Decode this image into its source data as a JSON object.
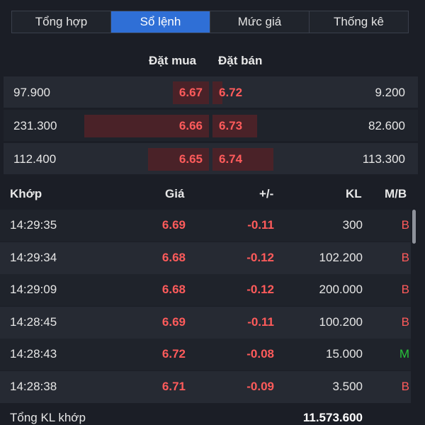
{
  "tabs": [
    {
      "label": "Tổng hợp",
      "active": false
    },
    {
      "label": "Sổ lệnh",
      "active": true
    },
    {
      "label": "Mức giá",
      "active": false
    },
    {
      "label": "Thống kê",
      "active": false
    }
  ],
  "orderbook": {
    "header": {
      "bid": "Đặt mua",
      "ask": "Đặt bán"
    },
    "rows": [
      {
        "bid_volume": "97.900",
        "bid_price": "6.67",
        "ask_price": "6.72",
        "ask_volume": "9.200",
        "bid_depth_pct": 29,
        "ask_depth_pct": 8
      },
      {
        "bid_volume": "231.300",
        "bid_price": "6.66",
        "ask_price": "6.73",
        "ask_volume": "82.600",
        "bid_depth_pct": 100,
        "ask_depth_pct": 36
      },
      {
        "bid_volume": "112.400",
        "bid_price": "6.65",
        "ask_price": "6.74",
        "ask_volume": "113.300",
        "bid_depth_pct": 49,
        "ask_depth_pct": 49
      }
    ]
  },
  "trades": {
    "header": {
      "time": "Khớp",
      "price": "Giá",
      "change": "+/-",
      "volume": "KL",
      "side": "M/B"
    },
    "rows": [
      {
        "time": "14:29:35",
        "price": "6.69",
        "change": "-0.11",
        "volume": "300",
        "side": "B"
      },
      {
        "time": "14:29:34",
        "price": "6.68",
        "change": "-0.12",
        "volume": "102.200",
        "side": "B"
      },
      {
        "time": "14:29:09",
        "price": "6.68",
        "change": "-0.12",
        "volume": "200.000",
        "side": "B"
      },
      {
        "time": "14:28:45",
        "price": "6.69",
        "change": "-0.11",
        "volume": "100.200",
        "side": "B"
      },
      {
        "time": "14:28:43",
        "price": "6.72",
        "change": "-0.08",
        "volume": "15.000",
        "side": "M"
      },
      {
        "time": "14:28:38",
        "price": "6.71",
        "change": "-0.09",
        "volume": "3.500",
        "side": "B"
      }
    ]
  },
  "footer": {
    "label": "Tổng KL khớp",
    "value": "11.573.600"
  },
  "colors": {
    "background": "#1b1e26",
    "accent": "#2f6fd6",
    "down": "#ff5b5b",
    "up": "#27c23a"
  }
}
